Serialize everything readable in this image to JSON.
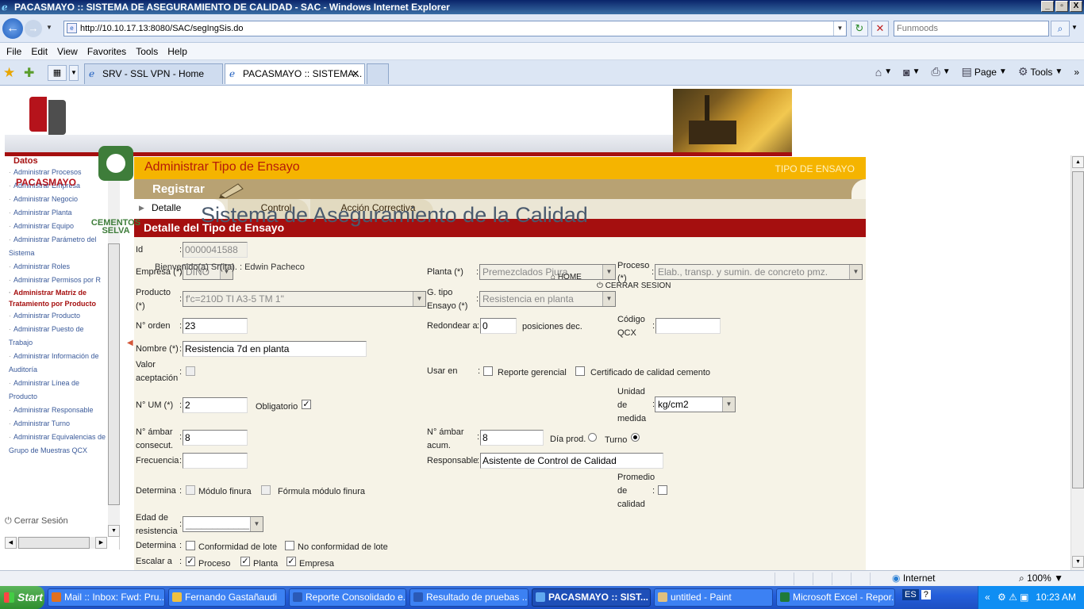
{
  "window": {
    "title": "PACASMAYO :: SISTEMA DE ASEGURAMIENTO DE CALIDAD - SAC - Windows Internet Explorer",
    "controls": [
      "_",
      "▫",
      "X"
    ]
  },
  "addressbar": {
    "url": "http://10.10.17.13:8080/SAC/segIngSis.do",
    "search_placeholder": "Funmoods"
  },
  "menubar": [
    "File",
    "Edit",
    "View",
    "Favorites",
    "Tools",
    "Help"
  ],
  "tabs": [
    {
      "label": "SRV - SSL VPN - Home",
      "active": false
    },
    {
      "label": "PACASMAYO :: SISTEMA...",
      "active": true
    }
  ],
  "commandbar": {
    "page": "Page",
    "tools": "Tools"
  },
  "banner": {
    "title": "Sistema de Aseguramiento de la Calidad",
    "logo_left": "PACASMAYO",
    "logo_right": "CEMENTOS SELVA",
    "welcome": "Bienvenido(a) Sr(ita). : Edwin Pacheco",
    "home": "HOME",
    "logout": "CERRAR SESION"
  },
  "sidebar": {
    "section": "Datos",
    "items": [
      {
        "label": "Administrar Procesos"
      },
      {
        "label": "Administrar Empresa"
      },
      {
        "label": "Administrar Negocio"
      },
      {
        "label": "Administrar Planta"
      },
      {
        "label": "Administrar Equipo"
      },
      {
        "label": "Administrar Parámetro del Sistema"
      },
      {
        "label": "Administrar Roles"
      },
      {
        "label": "Administrar Permisos por R"
      },
      {
        "label": "Administrar Matriz de Tratamiento por Producto"
      },
      {
        "label": "Administrar Producto"
      },
      {
        "label": "Administrar Puesto de Trabajo"
      },
      {
        "label": "Administrar Información de Auditoría"
      },
      {
        "label": "Administrar Línea de Producto"
      },
      {
        "label": "Administrar Responsable"
      },
      {
        "label": "Administrar Turno"
      },
      {
        "label": "Administrar Equivalencias de Grupo de Muestras QCX"
      }
    ],
    "logout": "Cerrar Sesión"
  },
  "main": {
    "title": "Administrar Tipo de Ensayo",
    "right_label": "TIPO DE ENSAYO",
    "mode": "Registrar",
    "tabs": [
      "Detalle",
      "Control",
      "Acción Correctiva"
    ],
    "section_title": "Detalle del Tipo de Ensayo"
  },
  "form": {
    "id": {
      "label": "Id",
      "value": "0000041588"
    },
    "empresa": {
      "label": "Empresa (*)",
      "value": "DINO"
    },
    "planta": {
      "label": "Planta (*)",
      "value": "Premezclados Piura"
    },
    "proceso": {
      "label_1": "Proceso",
      "label_2": "(*)",
      "value": "Elab., transp. y sumin. de concreto pmz."
    },
    "producto": {
      "label_1": "Producto",
      "label_2": "(*)",
      "value": "f'c=210D TI A3-5 TM 1\""
    },
    "g_tipo": {
      "label_1": "G. tipo",
      "label_2": "Ensayo (*)",
      "value": "Resistencia en planta"
    },
    "orden": {
      "label": "N° orden",
      "value": "23"
    },
    "redondear": {
      "label": "Redondear a",
      "value": "0",
      "suffix": "posiciones dec."
    },
    "codigo_qcx": {
      "label_1": "Código",
      "label_2": "QCX",
      "value": ""
    },
    "nombre": {
      "label": "Nombre (*)",
      "value": "Resistencia 7d en planta"
    },
    "valor_aceptacion": {
      "label_1": "Valor",
      "label_2": "aceptación"
    },
    "usar_en": {
      "label": "Usar en",
      "opt1": "Reporte gerencial",
      "opt2": "Certificado de calidad cemento"
    },
    "unidad_medida": {
      "label_1": "Unidad",
      "label_2": "de",
      "label_3": "medida",
      "value": "kg/cm2"
    },
    "num_um": {
      "label": "N° UM (*)",
      "value": "2"
    },
    "obligatorio": {
      "label": "Obligatorio"
    },
    "ambar_consecut": {
      "label_1": "N° ámbar",
      "label_2": "consecut.",
      "value": "8"
    },
    "ambar_acum": {
      "label_1": "N° ámbar",
      "label_2": "acum.",
      "value": "8"
    },
    "dia_prod": {
      "label": "Día prod."
    },
    "turno": {
      "label": "Turno"
    },
    "frecuencia": {
      "label": "Frecuencia",
      "value": ""
    },
    "responsable": {
      "label": "Responsable",
      "value": "Asistente de Control de Calidad"
    },
    "determina1": {
      "label": "Determina",
      "opt1": "Módulo finura",
      "opt2": "Fórmula módulo finura"
    },
    "promedio": {
      "label_1": "Promedio",
      "label_2": "de",
      "label_3": "calidad"
    },
    "edad": {
      "label_1": "Edad de",
      "label_2": "resistencia",
      "value": "____________"
    },
    "determina2": {
      "label": "Determina",
      "opt1": "Conformidad de lote",
      "opt2": "No conformidad de lote"
    },
    "escalar": {
      "label": "Escalar a",
      "opt1": "Proceso",
      "opt2": "Planta",
      "opt3": "Empresa"
    }
  },
  "statusbar": {
    "zone": "Internet",
    "zoom": "100%"
  },
  "taskbar": {
    "start": "Start",
    "tasks": [
      "Mail :: Inbox: Fwd: Pru...",
      "Fernando Gastañaudi",
      "Reporte Consolidado e...",
      "Resultado de pruebas ...",
      "PACASMAYO :: SIST...",
      "untitled - Paint",
      "Microsoft Excel - Repor..."
    ],
    "lang": "ES",
    "time": "10:23 AM"
  }
}
